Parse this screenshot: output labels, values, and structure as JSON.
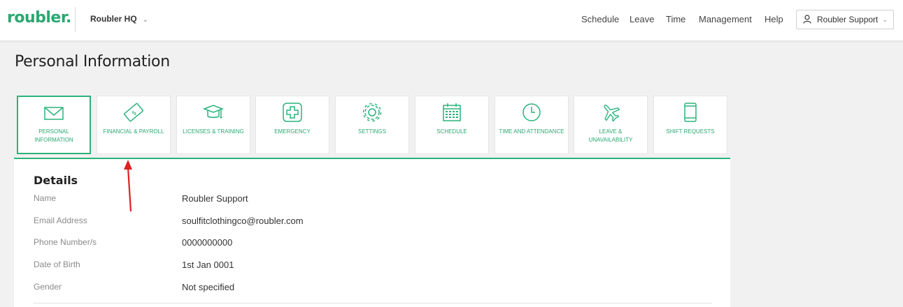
{
  "header": {
    "logo": "roubler.",
    "org_selector": "Roubler HQ",
    "nav": [
      "Schedule",
      "Leave",
      "Time",
      "Management",
      "Help"
    ],
    "user_menu": "Roubler Support"
  },
  "page": {
    "title": "Personal Information"
  },
  "tabs": [
    {
      "label": "PERSONAL INFORMATION",
      "icon": "envelope-icon",
      "active": true
    },
    {
      "label": "FINANCIAL & PAYROLL",
      "icon": "money-icon"
    },
    {
      "label": "LICENSES & TRAINING",
      "icon": "graduation-cap-icon"
    },
    {
      "label": "EMERGENCY",
      "icon": "medical-cross-icon"
    },
    {
      "label": "SETTINGS",
      "icon": "gear-icon"
    },
    {
      "label": "SCHEDULE",
      "icon": "calendar-icon"
    },
    {
      "label": "TIME AND ATTENDANCE",
      "icon": "clock-icon"
    },
    {
      "label": "LEAVE & UNAVAILABILITY",
      "icon": "airplane-icon"
    },
    {
      "label": "SHIFT REQUESTS",
      "icon": "mobile-icon"
    }
  ],
  "details": {
    "title": "Details",
    "fields": [
      {
        "label": "Name",
        "value": "Roubler Support"
      },
      {
        "label": "Email Address",
        "value": "soulfitclothingco@roubler.com"
      },
      {
        "label": "Phone Number/s",
        "value": "0000000000"
      },
      {
        "label": "Date of Birth",
        "value": "1st Jan 0001"
      },
      {
        "label": "Gender",
        "value": "Not specified"
      }
    ]
  },
  "colors": {
    "accent": "#2ab37a",
    "annotation_arrow": "#e02020"
  }
}
